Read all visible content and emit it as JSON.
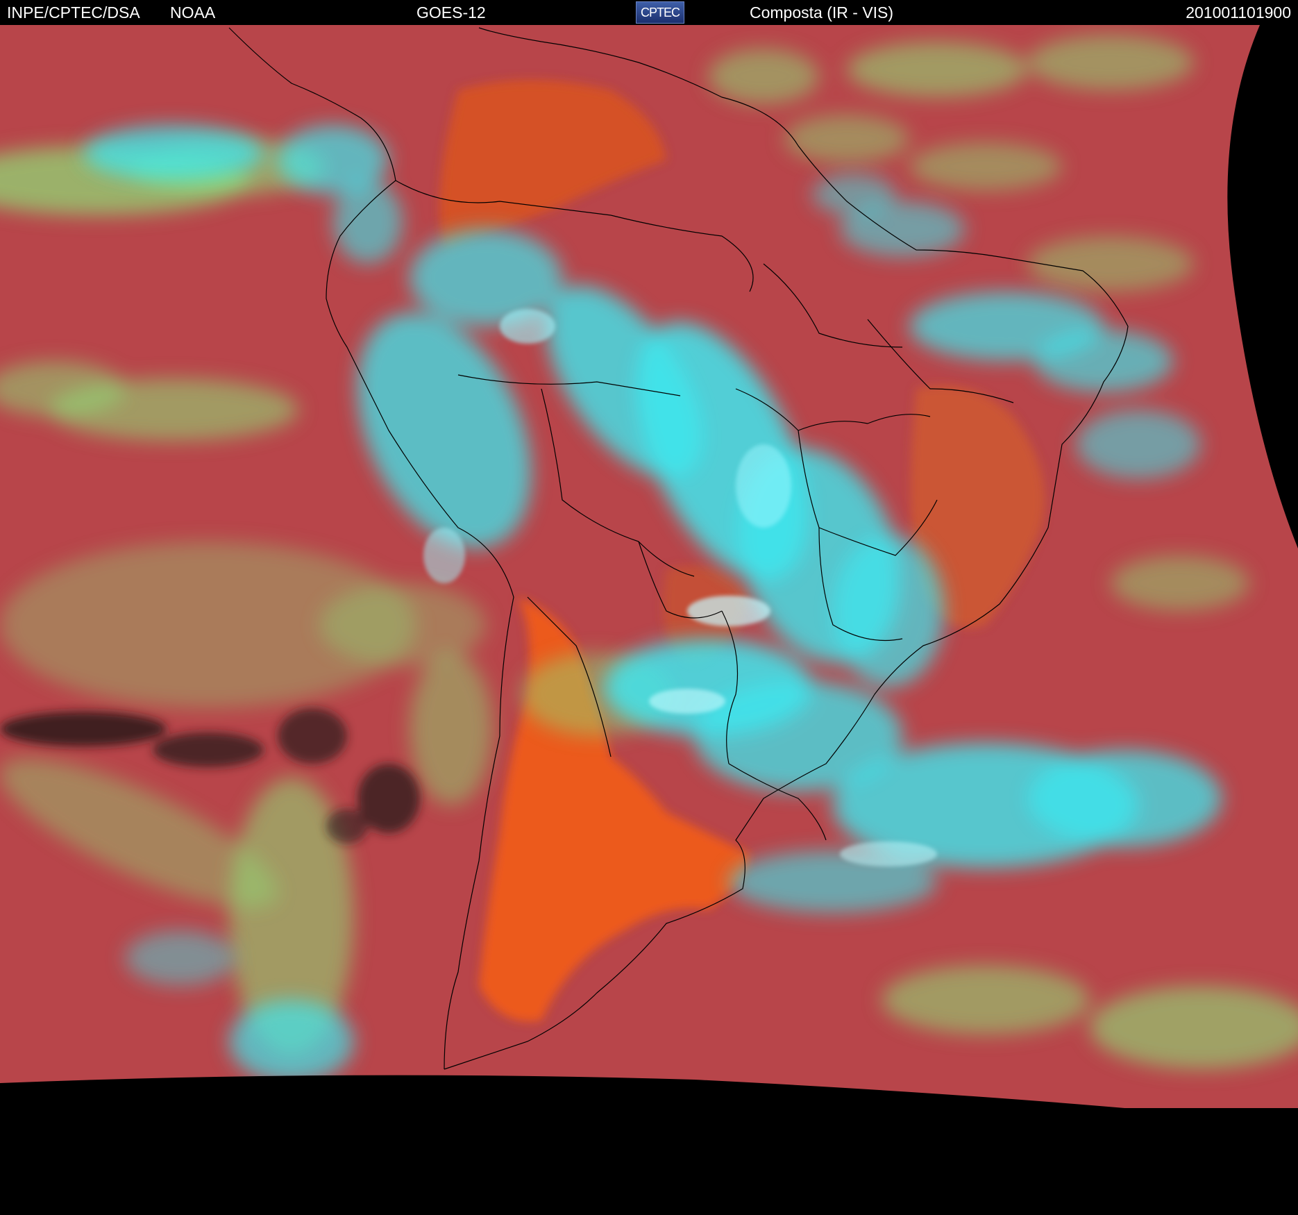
{
  "header": {
    "organization": "INPE/CPTEC/DSA",
    "agency": "NOAA",
    "satellite": "GOES-12",
    "product": "Composta (IR - VIS)",
    "timestamp": "201001101900",
    "logo_text": "CPTEC"
  },
  "colors": {
    "ocean": "#b8454a",
    "land_warm": "#e35a1c",
    "cloud_high": "#3ee6ee",
    "cloud_low": "#8fe078",
    "cold_sparse": "#2a1a1a",
    "no_data": "#000000",
    "borders": "#000000"
  }
}
